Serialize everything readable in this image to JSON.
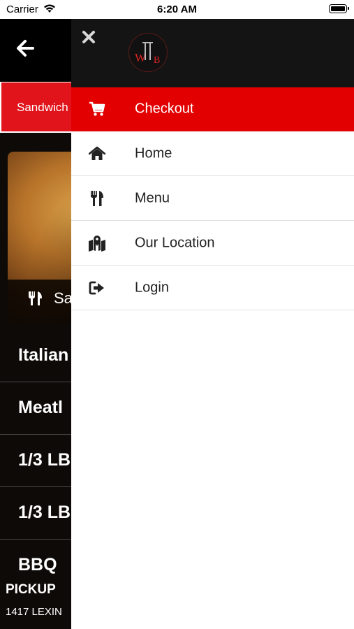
{
  "status_bar": {
    "carrier": "Carrier",
    "time": "6:20 AM"
  },
  "background_screen": {
    "tab_label": "Sandwich",
    "card_label": "Sa",
    "list_items": [
      "Italian",
      "Meatl",
      "1/3 LB",
      "1/3 LB",
      "BBQ"
    ],
    "footer_title": "PICKUP",
    "footer_address": "1417 LEXIN"
  },
  "drawer": {
    "logo_text": "WTB",
    "menu_items": [
      {
        "label": "Checkout",
        "icon": "cart-icon",
        "active": true
      },
      {
        "label": "Home",
        "icon": "home-icon",
        "active": false
      },
      {
        "label": "Menu",
        "icon": "utensils-icon",
        "active": false
      },
      {
        "label": "Our Location",
        "icon": "map-location-icon",
        "active": false
      },
      {
        "label": "Login",
        "icon": "sign-in-icon",
        "active": false
      }
    ]
  },
  "colors": {
    "accent": "#e20000",
    "drawer_header": "#141414"
  }
}
